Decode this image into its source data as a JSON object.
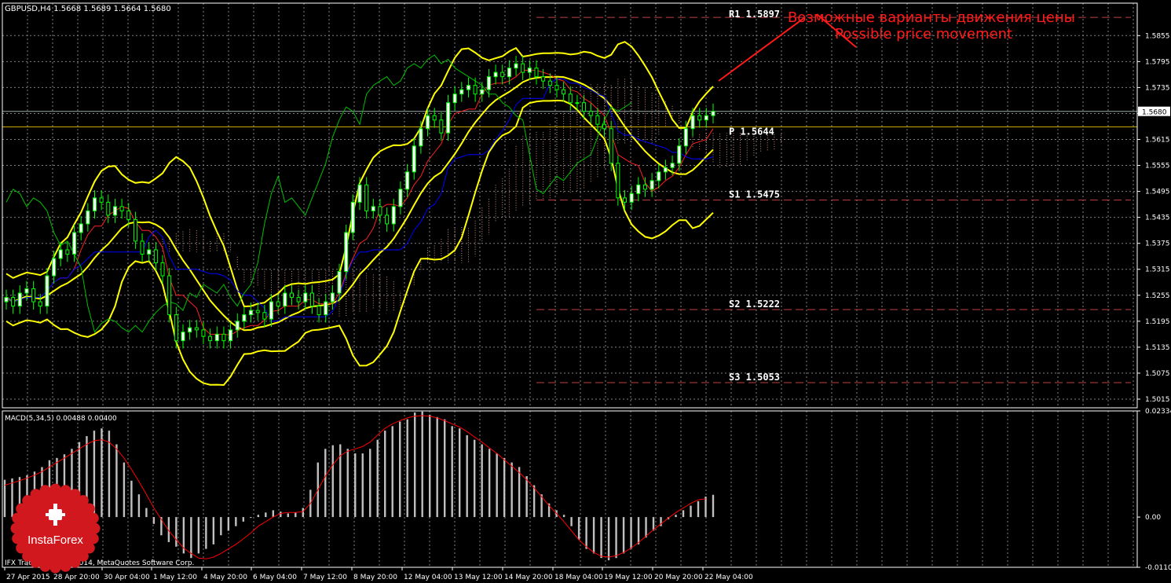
{
  "header": {
    "symbol_line": "GBPUSD,H4  1.5668 1.5689 1.5664 1.5680",
    "macd_line": "MACD(5,34,5) 0.00488 0.00400",
    "copyright": "IFX Trader, © 2001-2014, MetaQuotes Software Corp."
  },
  "annotation": {
    "ru": "Возможные варианты движения цены",
    "en": "Possible price movement",
    "color": "#ff1a1a"
  },
  "logo": {
    "text": "InstaForex",
    "color": "#d0181e"
  },
  "colors": {
    "candle_bull": "#ffffff",
    "candle_wick": "#00ff00",
    "bollinger": "#ffff00",
    "tenkan": "#ff2020",
    "kijun": "#0000ff",
    "chikou": "#00c000",
    "macd_bar": "#c0c0c0",
    "macd_signal": "#ff0000",
    "grid": "#808080",
    "pivot_line": "#c8a800",
    "level_line": "#a33"
  },
  "chart_data": [
    {
      "type": "candlestick",
      "title": "GBPUSD,H4",
      "ohlc_current": {
        "open": 1.5668,
        "high": 1.5689,
        "low": 1.5664,
        "close": 1.568
      },
      "current_price_label": "1.5680",
      "ylim": [
        1.4995,
        1.593
      ],
      "y_ticks": [
        "1.5855",
        "1.5795",
        "1.5735",
        "1.5675",
        "1.5615",
        "1.5555",
        "1.5495",
        "1.5435",
        "1.5375",
        "1.5315",
        "1.5255",
        "1.5195",
        "1.5135",
        "1.5075",
        "1.5015"
      ],
      "x_ticks": [
        "27 Apr 2015",
        "28 Apr 20:00",
        "30 Apr 04:00",
        "1 May 12:00",
        "4 May 20:00",
        "6 May 04:00",
        "7 May 12:00",
        "8 May 20:00",
        "12 May 04:00",
        "13 May 12:00",
        "14 May 20:00",
        "18 May 04:00",
        "19 May 12:00",
        "20 May 20:00",
        "22 May 04:00"
      ],
      "pivot_levels": [
        {
          "name": "R1",
          "value": 1.5897,
          "label": "R1  1.5897"
        },
        {
          "name": "P",
          "value": 1.5644,
          "label": "P  1.5644"
        },
        {
          "name": "S1",
          "value": 1.5475,
          "label": "S1  1.5475"
        },
        {
          "name": "S2",
          "value": 1.5222,
          "label": "S2  1.5222"
        },
        {
          "name": "S3",
          "value": 1.5053,
          "label": "S3  1.5053"
        }
      ],
      "close_series": [
        1.525,
        1.523,
        1.526,
        1.527,
        1.524,
        1.523,
        1.53,
        1.534,
        1.536,
        1.535,
        1.54,
        1.542,
        1.545,
        1.548,
        1.547,
        1.544,
        1.546,
        1.545,
        1.543,
        1.538,
        1.535,
        1.536,
        1.533,
        1.53,
        1.521,
        1.515,
        1.517,
        1.518,
        1.5175,
        1.516,
        1.515,
        1.5165,
        1.515,
        1.5175,
        1.5195,
        1.521,
        1.522,
        1.5215,
        1.52,
        1.524,
        1.523,
        1.526,
        1.525,
        1.524,
        1.526,
        1.523,
        1.521,
        1.524,
        1.526,
        1.531,
        1.54,
        1.547,
        1.551,
        1.545,
        1.546,
        1.544,
        1.542,
        1.546,
        1.55,
        1.554,
        1.56,
        1.564,
        1.567,
        1.566,
        1.563,
        1.57,
        1.572,
        1.573,
        1.574,
        1.572,
        1.573,
        1.576,
        1.577,
        1.576,
        1.578,
        1.579,
        1.577,
        1.578,
        1.576,
        1.575,
        1.574,
        1.573,
        1.572,
        1.57,
        1.57,
        1.568,
        1.567,
        1.565,
        1.564,
        1.556,
        1.548,
        1.547,
        1.549,
        1.551,
        1.55,
        1.552,
        1.554,
        1.555,
        1.556,
        1.56,
        1.564,
        1.567,
        1.566,
        1.567,
        1.568
      ]
    },
    {
      "type": "bar",
      "title": "MACD(5,34,5)",
      "values_current": {
        "macd": 0.00488,
        "signal": 0.004
      },
      "ylim": [
        -0.01104,
        0.02334
      ],
      "y_ticks": [
        "0.02334",
        "0.00",
        "-0.01104"
      ],
      "macd": [
        0.0082,
        0.0085,
        0.0088,
        0.0092,
        0.01,
        0.011,
        0.0125,
        0.013,
        0.0138,
        0.015,
        0.0165,
        0.0178,
        0.019,
        0.0195,
        0.019,
        0.016,
        0.012,
        0.008,
        0.005,
        0.002,
        -0.0015,
        -0.004,
        -0.0055,
        -0.0065,
        -0.008,
        -0.009,
        -0.008,
        -0.007,
        -0.006,
        -0.004,
        -0.003,
        -0.002,
        -0.001,
        0.0,
        0.0005,
        0.001,
        0.0015,
        0.0012,
        0.0008,
        0.001,
        0.002,
        0.006,
        0.012,
        0.015,
        0.0158,
        0.016,
        0.015,
        0.014,
        0.014,
        0.015,
        0.017,
        0.019,
        0.02,
        0.021,
        0.0215,
        0.023,
        0.0232,
        0.0225,
        0.022,
        0.0215,
        0.02,
        0.0195,
        0.018,
        0.017,
        0.016,
        0.015,
        0.014,
        0.013,
        0.012,
        0.011,
        0.009,
        0.007,
        0.005,
        0.003,
        0.0015,
        0.0005,
        -0.002,
        -0.005,
        -0.007,
        -0.008,
        -0.009,
        -0.0095,
        -0.009,
        -0.008,
        -0.007,
        -0.006,
        -0.0045,
        -0.003,
        -0.002,
        -0.0005,
        0.0005,
        0.0015,
        0.0025,
        0.0035,
        0.0045,
        0.0049
      ],
      "signal": [
        0.007,
        0.0075,
        0.008,
        0.0086,
        0.0092,
        0.01,
        0.011,
        0.012,
        0.013,
        0.014,
        0.015,
        0.016,
        0.0168,
        0.017,
        0.0165,
        0.015,
        0.013,
        0.0105,
        0.0078,
        0.005,
        0.002,
        -0.0005,
        -0.003,
        -0.005,
        -0.0068,
        -0.008,
        -0.009,
        -0.0092,
        -0.0088,
        -0.008,
        -0.007,
        -0.006,
        -0.0048,
        -0.0035,
        -0.002,
        -0.001,
        0.0,
        0.0008,
        0.001,
        0.001,
        0.0012,
        0.003,
        0.006,
        0.009,
        0.0115,
        0.0135,
        0.0145,
        0.015,
        0.0155,
        0.0165,
        0.018,
        0.0195,
        0.0205,
        0.0212,
        0.0218,
        0.0222,
        0.0223,
        0.0222,
        0.0218,
        0.0212,
        0.0205,
        0.0198,
        0.0188,
        0.0176,
        0.0165,
        0.0152,
        0.014,
        0.0126,
        0.0112,
        0.0098,
        0.0082,
        0.0064,
        0.0045,
        0.0025,
        0.0008,
        -0.001,
        -0.003,
        -0.005,
        -0.0065,
        -0.0078,
        -0.0086,
        -0.0088,
        -0.0085,
        -0.0078,
        -0.0068,
        -0.0056,
        -0.0042,
        -0.0028,
        -0.0015,
        -0.0002,
        0.001,
        0.002,
        0.003,
        0.0038,
        0.004
      ]
    }
  ]
}
